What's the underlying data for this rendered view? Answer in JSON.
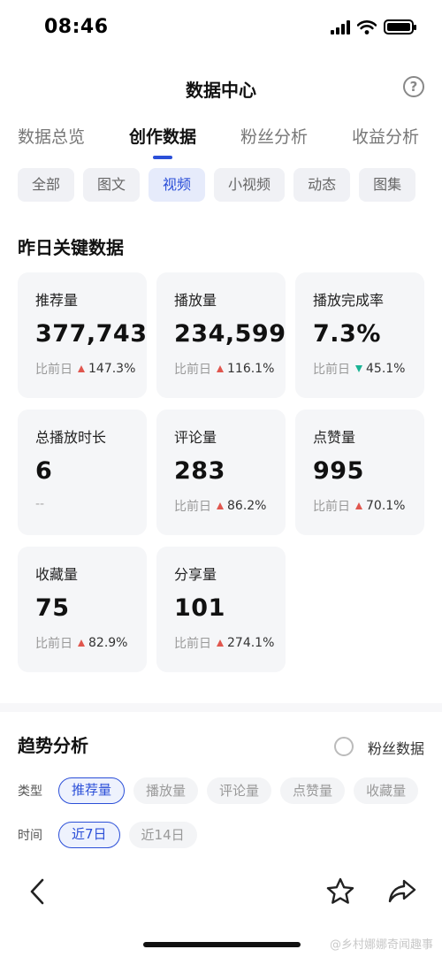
{
  "status": {
    "time": "08:46"
  },
  "header": {
    "title": "数据中心",
    "help_icon": "help-icon"
  },
  "tabs": [
    {
      "label": "数据总览",
      "active": false
    },
    {
      "label": "创作数据",
      "active": true
    },
    {
      "label": "粉丝分析",
      "active": false
    },
    {
      "label": "收益分析",
      "active": false
    }
  ],
  "subtabs": [
    {
      "label": "全部",
      "active": false
    },
    {
      "label": "图文",
      "active": false
    },
    {
      "label": "视频",
      "active": true
    },
    {
      "label": "小视频",
      "active": false
    },
    {
      "label": "动态",
      "active": false
    },
    {
      "label": "图集",
      "active": false
    }
  ],
  "key_data": {
    "title": "昨日关键数据",
    "cards": [
      {
        "label": "推荐量",
        "value": "377,743",
        "compare_label": "比前日",
        "direction": "up",
        "change": "147.3%"
      },
      {
        "label": "播放量",
        "value": "234,599",
        "compare_label": "比前日",
        "direction": "up",
        "change": "116.1%"
      },
      {
        "label": "播放完成率",
        "value": "7.3%",
        "compare_label": "比前日",
        "direction": "down",
        "change": "45.1%"
      },
      {
        "label": "总播放时长",
        "value": "6",
        "placeholder": "--"
      },
      {
        "label": "评论量",
        "value": "283",
        "compare_label": "比前日",
        "direction": "up",
        "change": "86.2%"
      },
      {
        "label": "点赞量",
        "value": "995",
        "compare_label": "比前日",
        "direction": "up",
        "change": "70.1%"
      },
      {
        "label": "收藏量",
        "value": "75",
        "compare_label": "比前日",
        "direction": "up",
        "change": "82.9%"
      },
      {
        "label": "分享量",
        "value": "101",
        "compare_label": "比前日",
        "direction": "up",
        "change": "274.1%"
      }
    ]
  },
  "trend": {
    "title": "趋势分析",
    "toggle_label": "粉丝数据",
    "type_label": "类型",
    "types": [
      {
        "label": "推荐量",
        "active": true
      },
      {
        "label": "播放量",
        "active": false
      },
      {
        "label": "评论量",
        "active": false
      },
      {
        "label": "点赞量",
        "active": false
      },
      {
        "label": "收藏量",
        "active": false
      }
    ],
    "time_label": "时间",
    "times": [
      {
        "label": "近7日",
        "active": true
      },
      {
        "label": "近14日",
        "active": false
      }
    ]
  },
  "bottom": {
    "watermark": "@乡村娜娜奇闻趣事"
  },
  "colors": {
    "accent": "#2b4fd8",
    "up": "#e0564e",
    "down": "#1ab394"
  }
}
